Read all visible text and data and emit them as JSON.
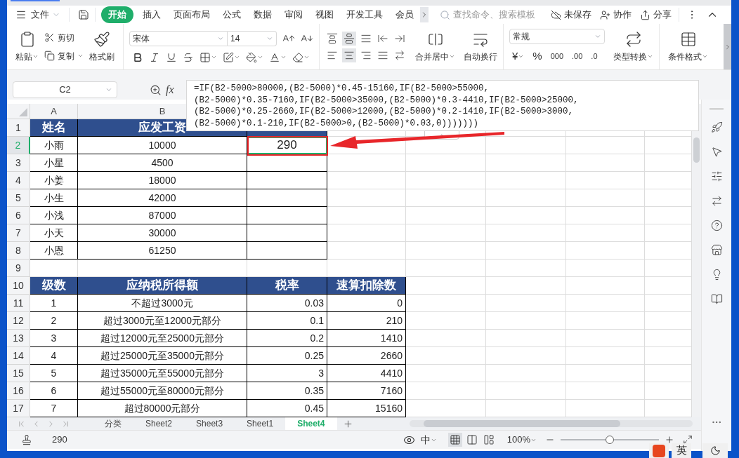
{
  "menu": {
    "file": "文件",
    "tabs": [
      {
        "label": "开始",
        "selected": true
      },
      {
        "label": "插入",
        "selected": false
      },
      {
        "label": "页面布局",
        "selected": false
      },
      {
        "label": "公式",
        "selected": false
      },
      {
        "label": "数据",
        "selected": false
      },
      {
        "label": "审阅",
        "selected": false
      },
      {
        "label": "视图",
        "selected": false
      },
      {
        "label": "开发工具",
        "selected": false
      },
      {
        "label": "会员",
        "selected": false
      }
    ],
    "search": {
      "placeholder": "查找命令、搜索模板"
    },
    "actions": [
      "未保存",
      "协作",
      "分享"
    ]
  },
  "ribbon": {
    "paste": "粘贴",
    "cut": "剪切",
    "copy": "复制",
    "format_painter": "格式刷",
    "font": "宋体",
    "font_size": "14",
    "merge": "合并居中",
    "wrap": "自动换行",
    "number_format": "常规",
    "number_buttons": [
      "¥",
      "%",
      "000",
      ".00",
      ".0"
    ],
    "convert": "类型转换",
    "conditional": "条件格式"
  },
  "formula_bar": {
    "cell": "C2",
    "fx": "fx",
    "formula_lines": [
      "=IF(B2-5000>80000,(B2-5000)*0.45-15160,IF(B2-5000>55000,",
      "(B2-5000)*0.35-7160,IF(B2-5000>35000,(B2-5000)*0.3-4410,IF(B2-5000>25000,",
      "(B2-5000)*0.25-2660,IF(B2-5000>12000,(B2-5000)*0.2-1410,IF(B2-5000>3000,",
      "(B2-5000)*0.1-210,IF(B2-5000>0,(B2-5000)*0.03,0)))))))"
    ]
  },
  "columns": [
    "A",
    "B"
  ],
  "rows": [
    {
      "number": "1",
      "kind": "header",
      "cells": [
        {
          "text": "姓名",
          "selected": false
        },
        {
          "text": "应发工资",
          "selected": false
        },
        {
          "selected": false
        }
      ]
    },
    {
      "number": "2",
      "kind": "data",
      "cells": [
        {
          "text": "小雨",
          "selected": false
        },
        {
          "text": "10000",
          "selected": false
        },
        {
          "text": "290",
          "selected": true
        }
      ]
    },
    {
      "number": "3",
      "kind": "data",
      "cells": [
        {
          "text": "小星",
          "selected": false
        },
        {
          "text": "4500",
          "selected": false
        },
        {
          "selected": false
        }
      ]
    },
    {
      "number": "4",
      "kind": "data",
      "cells": [
        {
          "text": "小姜",
          "selected": false
        },
        {
          "text": "18000",
          "selected": false
        },
        {
          "selected": false
        }
      ]
    },
    {
      "number": "5",
      "kind": "data",
      "cells": [
        {
          "text": "小生",
          "selected": false
        },
        {
          "text": "42000",
          "selected": false
        },
        {
          "selected": false
        }
      ]
    },
    {
      "number": "6",
      "kind": "data",
      "cells": [
        {
          "text": "小浅",
          "selected": false
        },
        {
          "text": "87000",
          "selected": false
        },
        {
          "selected": false
        }
      ]
    },
    {
      "number": "7",
      "kind": "data",
      "cells": [
        {
          "text": "小天",
          "selected": false
        },
        {
          "text": "30000",
          "selected": false
        },
        {
          "selected": false
        }
      ]
    },
    {
      "number": "8",
      "kind": "data",
      "cells": [
        {
          "text": "小恩",
          "selected": false
        },
        {
          "text": "61250",
          "selected": false
        },
        {
          "selected": false
        }
      ]
    },
    {
      "number": "9",
      "kind": "blank",
      "cells": []
    },
    {
      "number": "10",
      "kind": "header",
      "cells": [
        {
          "text": "级数",
          "selected": false
        },
        {
          "text": "应纳税所得额",
          "selected": false
        },
        {
          "text": "税率",
          "selected": false
        },
        {
          "text": "速算扣除数",
          "selected": false
        }
      ]
    },
    {
      "number": "11",
      "kind": "data",
      "cells": [
        {
          "text": "1",
          "selected": false
        },
        {
          "text": "不超过3000元",
          "selected": false
        },
        {
          "text": "0.03",
          "selected": false
        },
        {
          "text": "0",
          "selected": false
        }
      ]
    },
    {
      "number": "12",
      "kind": "data",
      "cells": [
        {
          "text": "2",
          "selected": false
        },
        {
          "text": "超过3000元至12000元部分",
          "selected": false
        },
        {
          "text": "0.1",
          "selected": false
        },
        {
          "text": "210",
          "selected": false
        }
      ]
    },
    {
      "number": "13",
      "kind": "data",
      "cells": [
        {
          "text": "3",
          "selected": false
        },
        {
          "text": "超过12000元至25000元部分",
          "selected": false
        },
        {
          "text": "0.2",
          "selected": false
        },
        {
          "text": "1410",
          "selected": false
        }
      ]
    },
    {
      "number": "14",
      "kind": "data",
      "cells": [
        {
          "text": "4",
          "selected": false
        },
        {
          "text": "超过25000元至35000元部分",
          "selected": false
        },
        {
          "text": "0.25",
          "selected": false
        },
        {
          "text": "2660",
          "selected": false
        }
      ]
    },
    {
      "number": "15",
      "kind": "data",
      "cells": [
        {
          "text": "5",
          "selected": false
        },
        {
          "text": "超过35000元至55000元部分",
          "selected": false
        },
        {
          "text": "3",
          "selected": false
        },
        {
          "text": "4410",
          "selected": false
        }
      ]
    },
    {
      "number": "16",
      "kind": "data",
      "cells": [
        {
          "text": "6",
          "selected": false
        },
        {
          "text": "超过55000元至80000元部分",
          "selected": false
        },
        {
          "text": "0.35",
          "selected": false
        },
        {
          "text": "7160",
          "selected": false
        }
      ]
    },
    {
      "number": "17",
      "kind": "data",
      "cells": [
        {
          "text": "7",
          "selected": false
        },
        {
          "text": "超过80000元部分",
          "selected": false
        },
        {
          "text": "0.45",
          "selected": false
        },
        {
          "text": "15160",
          "selected": false
        }
      ]
    }
  ],
  "sheet_tabs": [
    {
      "label": "分类",
      "selected": false
    },
    {
      "label": "Sheet2",
      "selected": false
    },
    {
      "label": "Sheet3",
      "selected": false
    },
    {
      "label": "Sheet1",
      "selected": false
    },
    {
      "label": "Sheet4",
      "selected": true
    }
  ],
  "status_bar": {
    "value": "290",
    "input_mode": "中",
    "views": [
      {
        "kind": "normal",
        "selected": true
      },
      {
        "kind": "page",
        "selected": false
      },
      {
        "kind": "break",
        "selected": false
      }
    ],
    "zoom": "100%",
    "zoom_slider": {
      "level": 0.5
    }
  },
  "taskbar": {
    "ime": "英"
  }
}
